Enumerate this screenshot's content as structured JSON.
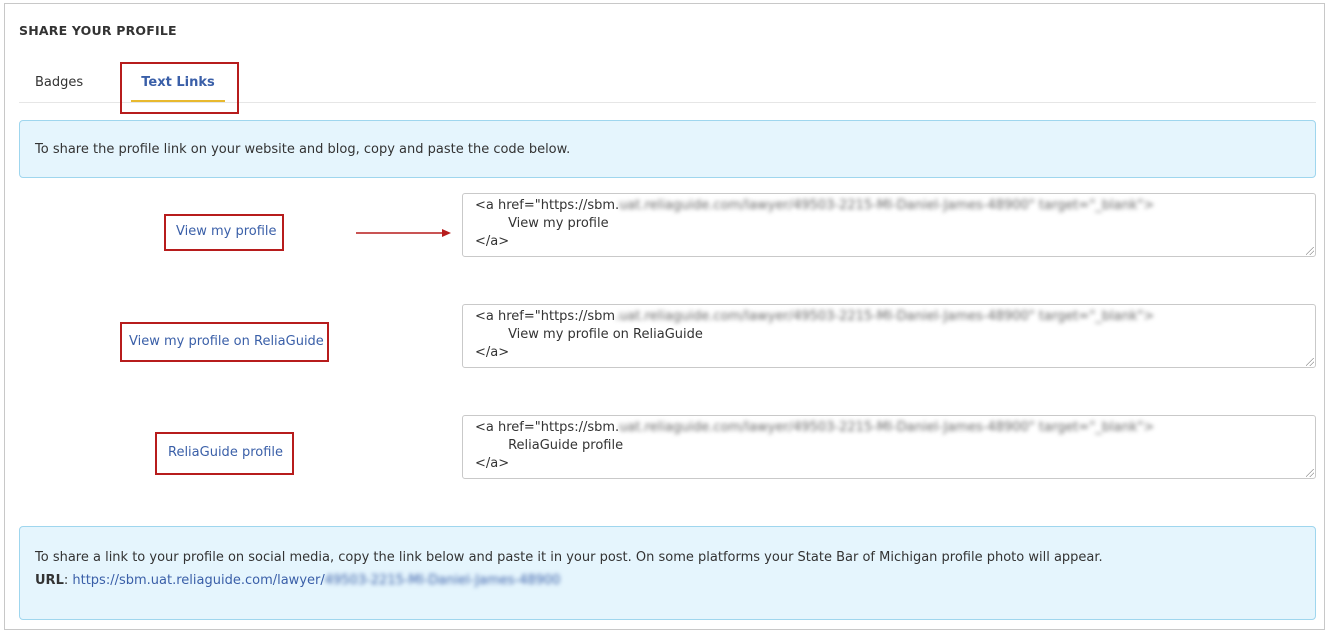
{
  "section_title": "SHARE YOUR PROFILE",
  "tabs": [
    {
      "label": "Badges",
      "active": false
    },
    {
      "label": "Text Links",
      "active": true
    }
  ],
  "intro_text": "To share the profile link on your website and blog, copy and paste the code below.",
  "snippets": [
    {
      "link_label": "View my profile",
      "code_prefix": "<a href=\"https://sbm.",
      "code_blurred": "uat.reliaguide.com/lawyer/49503-2215-MI-Daniel-James-48900\" target=\"_blank\">",
      "code_text": "View my profile",
      "code_close": "</a>"
    },
    {
      "link_label": "View my profile on ReliaGuide",
      "code_prefix": "<a href=\"https://sbm",
      "code_blurred": ".uat.reliaguide.com/lawyer/49503-2215-MI-Daniel-James-48900\" target=\"_blank\">",
      "code_text": "View my profile on ReliaGuide",
      "code_close": "</a>"
    },
    {
      "link_label": "ReliaGuide profile",
      "code_prefix": "<a href=\"https://sbm.",
      "code_blurred": "uat.reliaguide.com/lawyer/49503-2215-MI-Daniel-James-48900\" target=\"_blank\">",
      "code_text": "ReliaGuide profile",
      "code_close": "</a>"
    }
  ],
  "social": {
    "text": "To share a link to your profile on social media, copy the link below and paste it in your post. On some platforms your State Bar of Michigan profile photo will appear.",
    "url_label": "URL",
    "url_visible": "https://sbm.uat.reliaguide.com/lawyer/",
    "url_blurred": "49503-2215-MI-Daniel-James-48900"
  },
  "colors": {
    "highlight": "#b71c1c",
    "link": "#3a5fa8",
    "tab_underline": "#e8b92e",
    "info_bg": "#e5f5fd"
  }
}
